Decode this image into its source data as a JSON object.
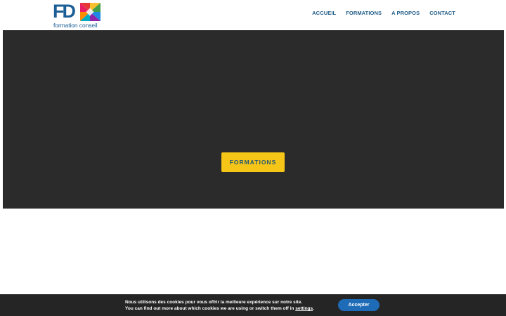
{
  "header": {
    "logo": {
      "letters": "FD",
      "tagline": "formation conseil",
      "mark_colors": [
        "#e53935",
        "#fbc02d",
        "#43a047",
        "#1e88e5",
        "#8e24aa",
        "#00acc1",
        "#fb8c00",
        "#e91e63"
      ]
    },
    "nav": [
      {
        "label": "ACCUEIL"
      },
      {
        "label": "FORMATIONS"
      },
      {
        "label": "A PROPOS"
      },
      {
        "label": "CONTACT"
      }
    ]
  },
  "hero": {
    "button_label": "FORMATIONS"
  },
  "cookie_bar": {
    "line1": "Nous utilisons des cookies pour vous offrir la meilleure expérience sur notre site.",
    "line2_prefix": "You can find out more about which cookies we are using or switch them off in",
    "settings_link": "settings",
    "line2_suffix": ".",
    "accept_label": "Accepter"
  },
  "colors": {
    "brand_blue": "#1b5e96",
    "nav_text": "#1e5b88",
    "hero_bg": "#2b2b2b",
    "cta_yellow": "#f5c518",
    "cookie_bg": "#252525",
    "accept_blue": "#1e6bb8"
  }
}
